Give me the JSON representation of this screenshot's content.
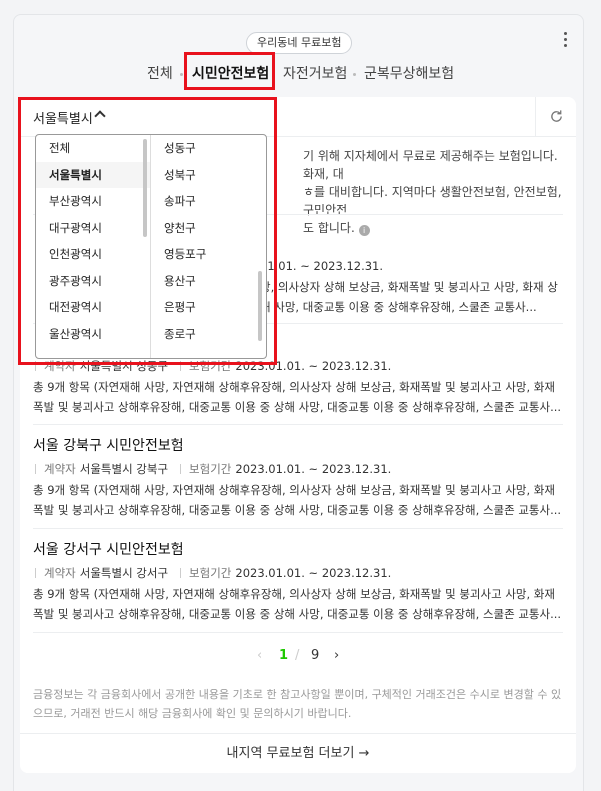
{
  "header": {
    "pill_label": "우리동네 무료보험",
    "tabs": [
      {
        "label": "전체"
      },
      {
        "label": "시민안전보험"
      },
      {
        "label": "자전거보험"
      },
      {
        "label": "군복무상해보험"
      }
    ],
    "active_tab": "시민안전보험"
  },
  "filter": {
    "region_label": "서울특별시"
  },
  "description": {
    "line1": "기 위해 지자체에서 무료로 제공해주는 보험입니다. 화재, 대",
    "line2": "ㅎ를 대비합니다. 지역마다 생활안전보험, 안전보험, 구민안전",
    "line3": "도 합니다."
  },
  "dropdown": {
    "left_items": [
      "전체",
      "서울특별시",
      "부산광역시",
      "대구광역시",
      "인천광역시",
      "광주광역시",
      "대전광역시",
      "울산광역시"
    ],
    "right_items": [
      "성동구",
      "성북구",
      "송파구",
      "양천구",
      "영등포구",
      "용산구",
      "은평구",
      "종로구"
    ],
    "selected": "서울특별시"
  },
  "items": [
    {
      "title": "",
      "meta_contractor_key": "",
      "meta_contractor": "",
      "meta_period_key": "",
      "meta_period": "01.01. ~ 2023.12.31.",
      "body": "망, 의사상자 상해 보상금, 화재폭발 및 붕괴사고 사망, 화재 상해 사망, 대중교통 이용 중 상해후유장해, 스쿨존 교통사..."
    },
    {
      "title": "",
      "meta_contractor_key": "계약자",
      "meta_contractor": "서울특별시 성동구",
      "meta_period_key": "보험기간",
      "meta_period": "2023.01.01. ~ 2023.12.31.",
      "body": "총 9개 항목 (자연재해 사망, 자연재해 상해후유장해, 의사상자 상해 보상금, 화재폭발 및 붕괴사고 사망, 화재폭발 및 붕괴사고 상해후유장해, 대중교통 이용 중 상해 사망, 대중교통 이용 중 상해후유장해, 스쿨존 교통사..."
    },
    {
      "title": "서울 강북구 시민안전보험",
      "meta_contractor_key": "계약자",
      "meta_contractor": "서울특별시 강북구",
      "meta_period_key": "보험기간",
      "meta_period": "2023.01.01. ~ 2023.12.31.",
      "body": "총 9개 항목 (자연재해 사망, 자연재해 상해후유장해, 의사상자 상해 보상금, 화재폭발 및 붕괴사고 사망, 화재폭발 및 붕괴사고 상해후유장해, 대중교통 이용 중 상해 사망, 대중교통 이용 중 상해후유장해, 스쿨존 교통사..."
    },
    {
      "title": "서울 강서구 시민안전보험",
      "meta_contractor_key": "계약자",
      "meta_contractor": "서울특별시 강서구",
      "meta_period_key": "보험기간",
      "meta_period": "2023.01.01. ~ 2023.12.31.",
      "body": "총 9개 항목 (자연재해 사망, 자연재해 상해후유장해, 의사상자 상해 보상금, 화재폭발 및 붕괴사고 사망, 화재폭발 및 붕괴사고 상해후유장해, 대중교통 이용 중 상해 사망, 대중교통 이용 중 상해후유장해, 스쿨존 교통사..."
    }
  ],
  "pagination": {
    "current": "1",
    "separator": "/",
    "total": "9"
  },
  "disclaimer": "금융정보는 각 금융회사에서 공개한 내용을 기초로 한 참고사항일 뿐이며, 구체적인 거래조건은 수시로 변경할 수 있으므로, 거래전 반드시 해당 금융회사에 확인 및 문의하시기 바랍니다.",
  "more_link": "내지역 무료보험 더보기 →",
  "colors": {
    "highlight_box": "#e8121d",
    "page_active": "#1ec800"
  },
  "icons": {
    "refresh": "refresh-icon",
    "region_toggle": "chevron-up-icon",
    "menu": "more-vertical-icon"
  }
}
